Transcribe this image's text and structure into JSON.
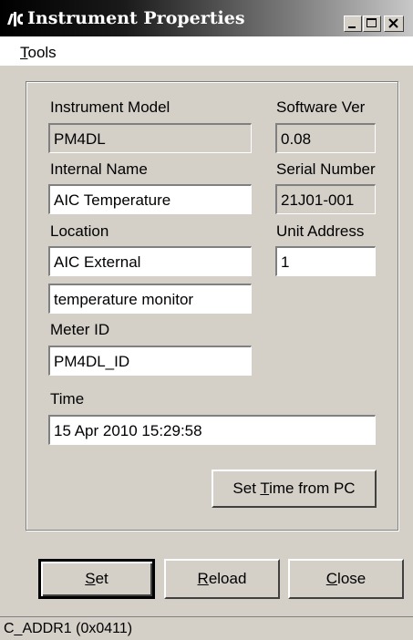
{
  "window": {
    "title": "Instrument Properties"
  },
  "menu": {
    "tools_accel": "T",
    "tools_rest": "ools"
  },
  "form": {
    "instrument_model_label": "Instrument Model",
    "instrument_model_value": "PM4DL",
    "software_ver_label": "Software Ver",
    "software_ver_value": "0.08",
    "internal_name_label": "Internal Name",
    "internal_name_value": "AIC Temperature",
    "serial_number_label": "Serial Number",
    "serial_number_value": "21J01-001",
    "location_label": "Location",
    "location_value": "AIC External",
    "location_line2_value": "temperature  monitor",
    "unit_address_label": "Unit Address",
    "unit_address_value": "1",
    "meter_id_label": "Meter ID",
    "meter_id_value": "PM4DL_ID",
    "time_label": "Time",
    "time_value": "15 Apr 2010 15:29:58"
  },
  "buttons": {
    "set_time_prefix": "Set ",
    "set_time_accel": "T",
    "set_time_rest": "ime from PC",
    "set_accel": "S",
    "set_rest": "et",
    "reload_accel": "R",
    "reload_rest": "eload",
    "close_accel": "C",
    "close_rest": "lose"
  },
  "status": {
    "text": "C_ADDR1 (0x0411)"
  },
  "icons": {
    "app": "instrument-app-icon",
    "minimize": "minimize-icon",
    "maximize": "maximize-icon",
    "close": "close-icon"
  }
}
